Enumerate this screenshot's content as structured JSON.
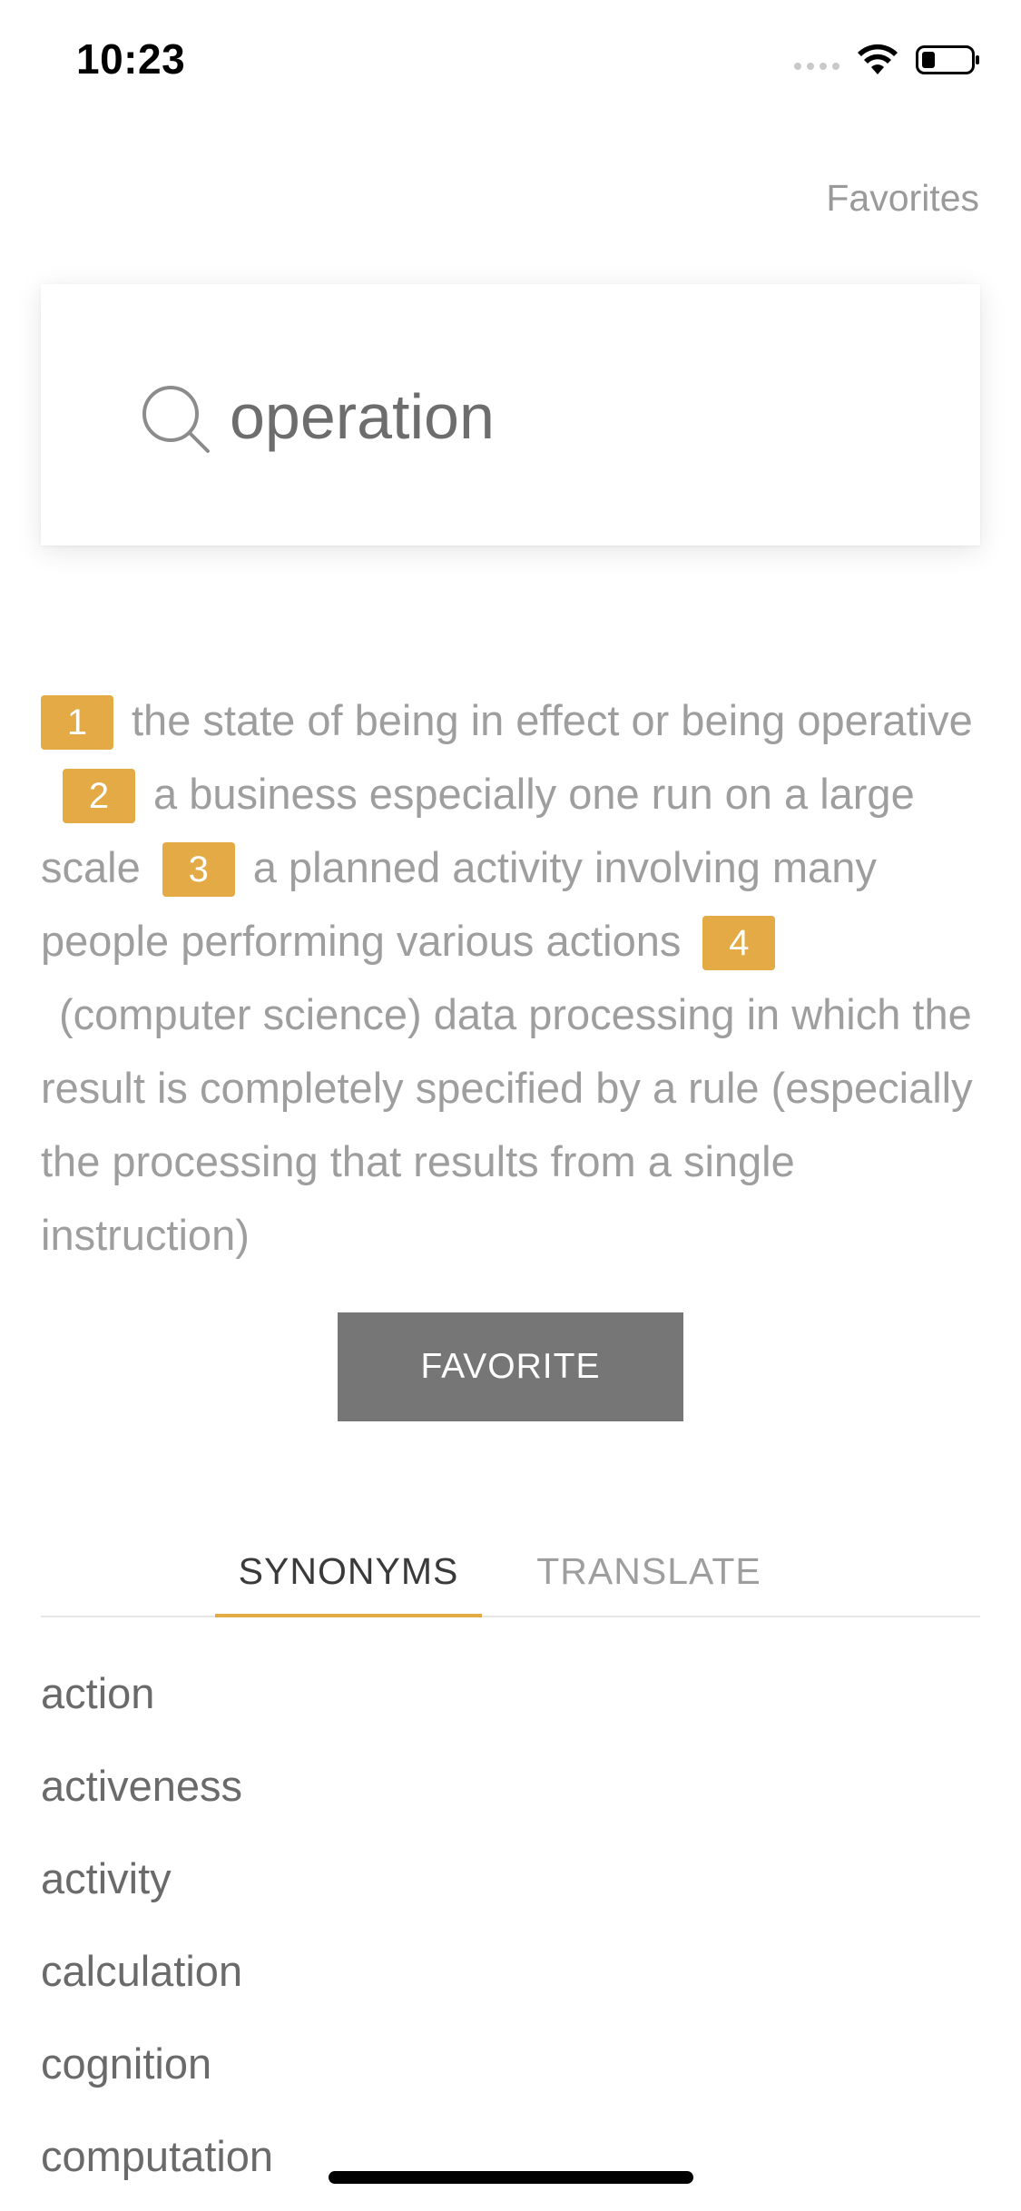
{
  "status_bar": {
    "time": "10:23",
    "icons": [
      "cellular-signal-icon",
      "wifi-icon",
      "battery-icon"
    ]
  },
  "header": {
    "favorites_label": "Favorites"
  },
  "search": {
    "value": "operation",
    "icon": "search-icon"
  },
  "definitions": [
    {
      "num": "1",
      "text": "the state of being in effect or being operative"
    },
    {
      "num": "2",
      "text": "a business especially one run on a large scale"
    },
    {
      "num": "3",
      "text": "a planned activity involving many people performing various actions"
    },
    {
      "num": "4",
      "text": "(computer science) data processing in which the result is completely specified by a rule (especially the processing that results from a single instruction)"
    }
  ],
  "favorite_button": {
    "label": "FAVORITE"
  },
  "tabs": [
    {
      "label": "SYNONYMS",
      "active": true
    },
    {
      "label": "TRANSLATE",
      "active": false
    }
  ],
  "synonyms": [
    "action",
    "activeness",
    "activity",
    "calculation",
    "cognition",
    "computation"
  ],
  "colors": {
    "accent": "#e3aa45",
    "button_bg": "#767676",
    "text_muted": "#9e9e9e",
    "text_dark": "#6a6a6a"
  }
}
